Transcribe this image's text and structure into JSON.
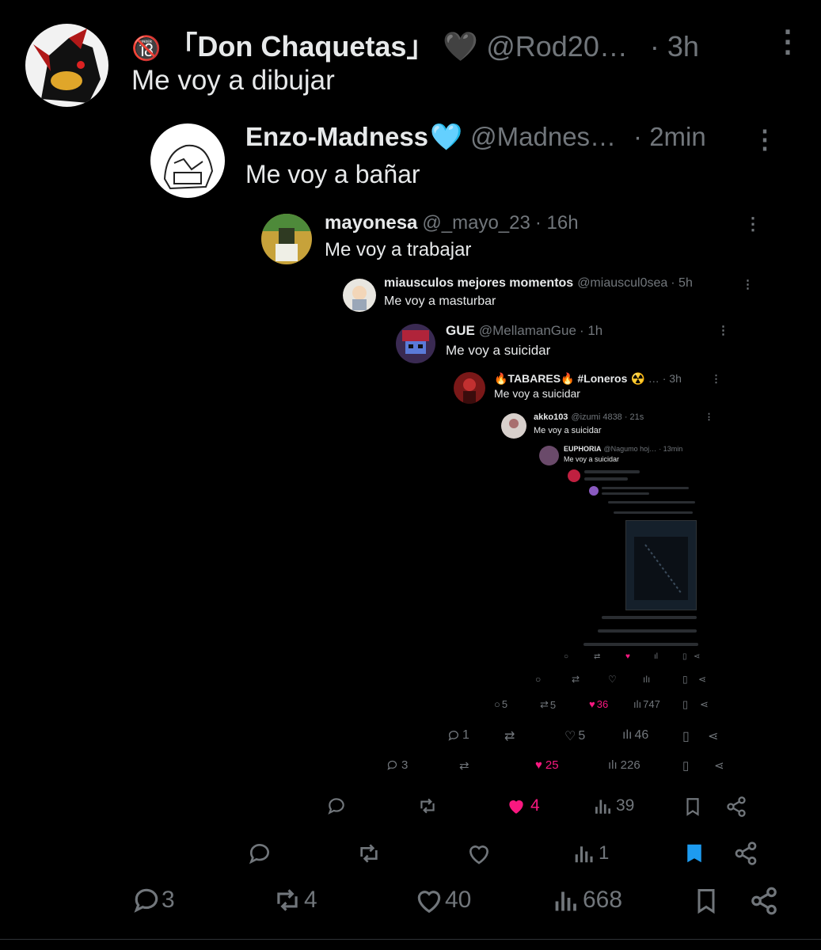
{
  "posts": [
    {
      "emoji": "🔞",
      "name": "「Don Chaquetas」",
      "badge": "🖤",
      "handle": "@Rod20…",
      "time": "· 3h",
      "text": "Me voy a dibujar",
      "replies": "3",
      "reposts": "4",
      "likes": "40",
      "views": "668"
    },
    {
      "name": "Enzo-Madness",
      "badge": "🩵",
      "handle": "@Madnes…",
      "time": "· 2min",
      "text": "Me voy a bañar",
      "replies": "",
      "reposts": "",
      "likes": "",
      "views": "1"
    },
    {
      "name": "mayonesa",
      "handle": "@_mayo_23",
      "time": "· 16h",
      "text": "Me voy a trabajar",
      "replies": "",
      "reposts": "",
      "likes": "4",
      "views": "39"
    },
    {
      "name": "miausculos mejores momentos",
      "handle": "@miauscul0sea",
      "time": "· 5h",
      "text": "Me voy a masturbar",
      "replies": "3",
      "reposts": "",
      "likes": "25",
      "views": "226"
    },
    {
      "name": "GUE",
      "handle": "@MellamanGue",
      "time": "· 1h",
      "text": "Me voy a suicidar",
      "replies": "1",
      "reposts": "",
      "likes": "5",
      "views": "46"
    },
    {
      "name": "🔥TABARES🔥 #Loneros",
      "handle": "☢️ …",
      "time": "· 3h",
      "text": "Me voy a suicidar",
      "replies": "5",
      "reposts": "5",
      "likes": "36",
      "views": "747"
    },
    {
      "name": "akko103",
      "handle": "@izumi 4838",
      "time": "· 21s",
      "text": "Me voy a suicidar"
    },
    {
      "name": "EUPHORIA",
      "handle": "@Nagumo hoj…",
      "time": "· 13min",
      "text": "Me voy a suicidar"
    }
  ],
  "colors": {
    "background": "#000000",
    "text": "#e7e9ea",
    "muted": "#71767b",
    "like": "#f91880",
    "bookmark": "#1d9bf0"
  },
  "icons": [
    "reply-icon",
    "repost-icon",
    "like-icon",
    "views-icon",
    "bookmark-icon",
    "share-icon",
    "more-icon"
  ]
}
